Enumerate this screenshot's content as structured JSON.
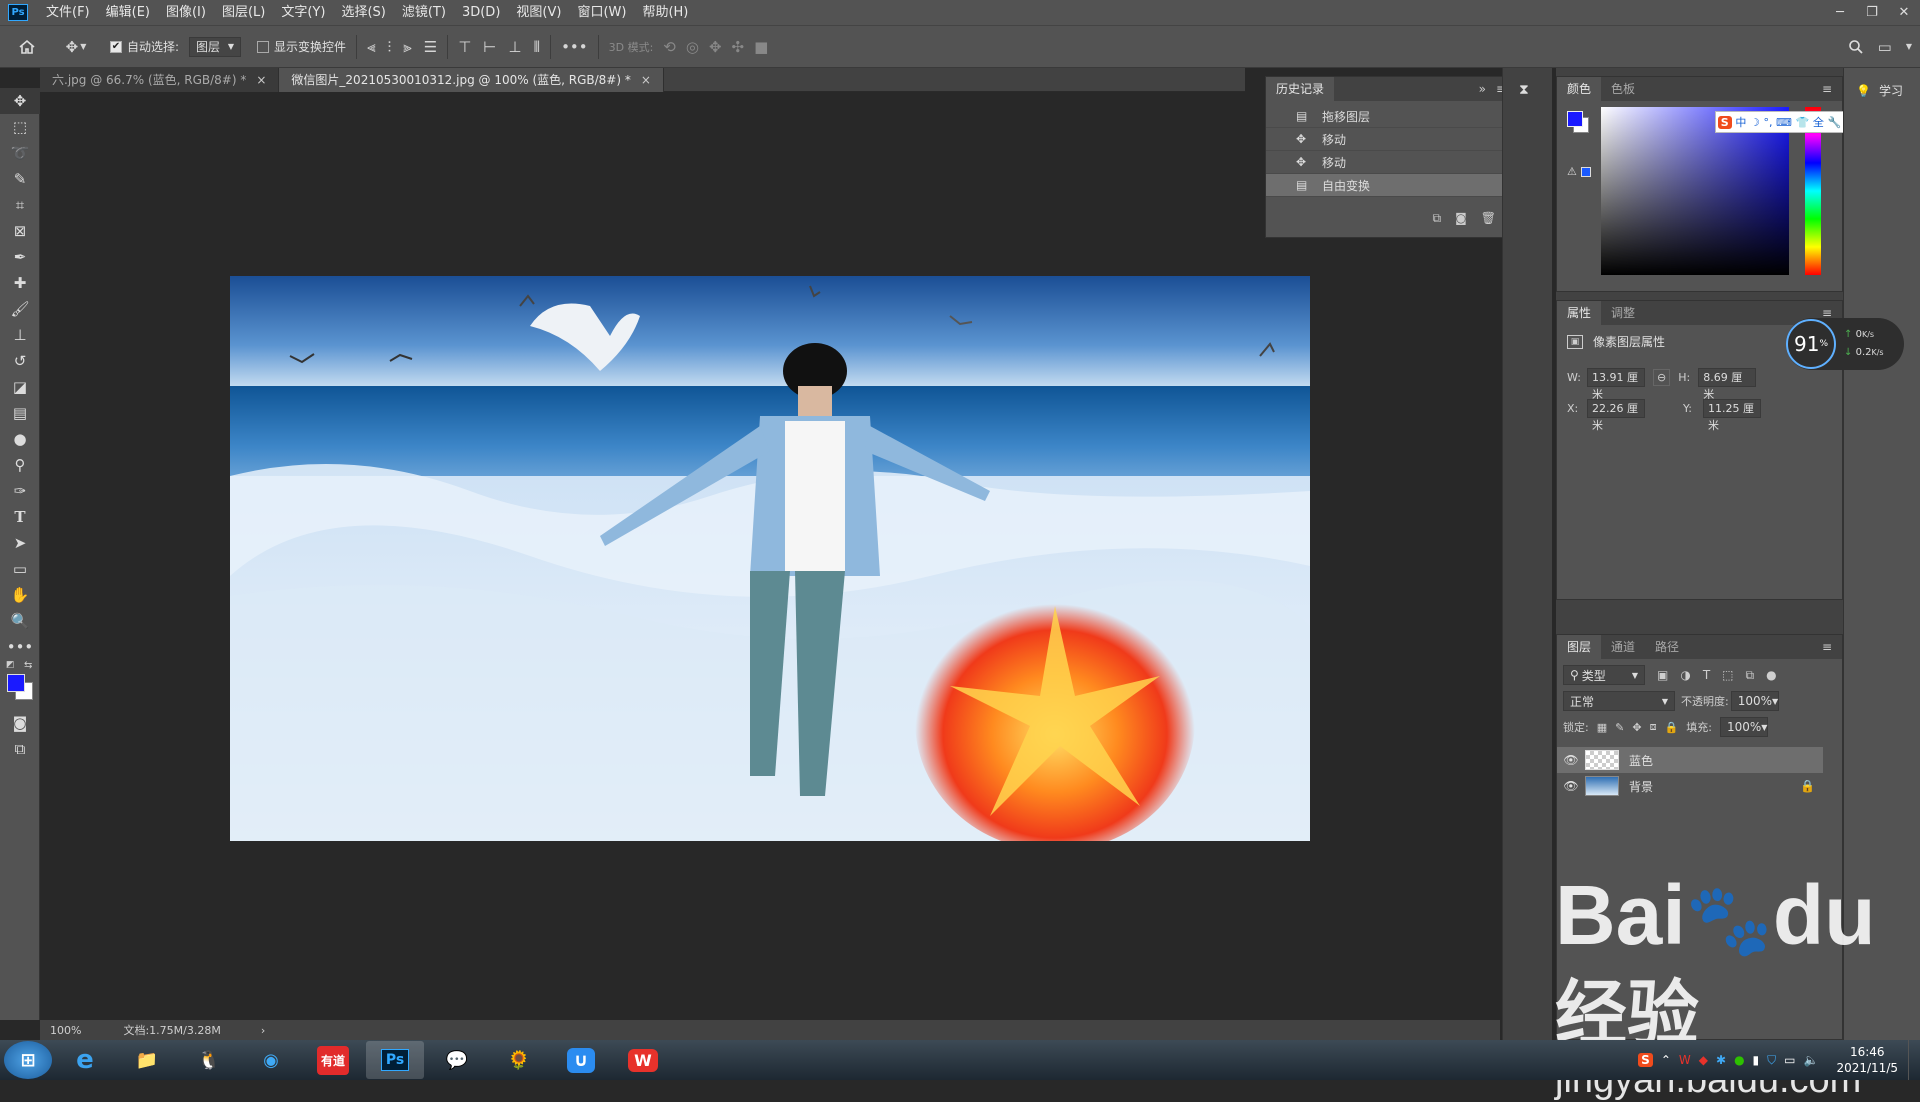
{
  "app": {
    "logo": "Ps"
  },
  "menu": [
    "文件(F)",
    "编辑(E)",
    "图像(I)",
    "图层(L)",
    "文字(Y)",
    "选择(S)",
    "滤镜(T)",
    "3D(D)",
    "视图(V)",
    "窗口(W)",
    "帮助(H)"
  ],
  "options": {
    "auto_select_label": "自动选择:",
    "auto_select_checked": true,
    "auto_select_target": "图层",
    "show_transform_label": "显示变换控件",
    "mode_3d_label": "3D 模式:"
  },
  "tabs": [
    {
      "label": "六.jpg @ 66.7% (蓝色, RGB/8#) *",
      "active": false
    },
    {
      "label": "微信图片_20210530010312.jpg @ 100% (蓝色, RGB/8#) *",
      "active": true
    }
  ],
  "history": {
    "title": "历史记录",
    "items": [
      "拖移图层",
      "移动",
      "移动",
      "自由变换"
    ],
    "selected_index": 3
  },
  "color_panel": {
    "tabs": [
      "颜色",
      "色板"
    ],
    "foreground": "#1a1aff",
    "background": "#ffffff"
  },
  "learn": {
    "label": "学习"
  },
  "properties": {
    "tabs": [
      "属性",
      "调整"
    ],
    "title": "像素图层属性",
    "w_label": "W:",
    "w": "13.91 厘米",
    "h_label": "H:",
    "h": "8.69 厘米",
    "x_label": "X:",
    "x": "22.26 厘米",
    "y_label": "Y:",
    "y": "11.25 厘米"
  },
  "net_widget": {
    "percent": "91",
    "percent_sign": "%",
    "up": "0",
    "down": "0.2",
    "unit": "K/s"
  },
  "layers": {
    "tabs": [
      "图层",
      "通道",
      "路径"
    ],
    "filter": "类型",
    "blend": "正常",
    "opacity_label": "不透明度:",
    "opacity": "100%",
    "lock_label": "锁定:",
    "fill_label": "填充:",
    "fill": "100%",
    "items": [
      {
        "name": "蓝色",
        "selected": true,
        "locked": false
      },
      {
        "name": "背景",
        "selected": false,
        "locked": true
      }
    ]
  },
  "status": {
    "zoom": "100%",
    "doc": "文档:1.75M/3.28M"
  },
  "ime": {
    "items": [
      "S",
      "中",
      "☽",
      "°,",
      "⌨",
      "👕",
      "全",
      "🔧"
    ]
  },
  "taskbar": {
    "apps": [
      "start",
      "ie",
      "explorer",
      "qq",
      "browser",
      "youdao",
      "photoshop",
      "wechat",
      "game",
      "baidu-netdisk",
      "wps"
    ],
    "youdao_label": "有道",
    "time": "16:46",
    "date": "2021/11/5"
  },
  "watermark": {
    "brand": "Bai",
    "brand2": "du",
    "cn": "经验",
    "url": "jingyan.baidu.com"
  },
  "colors": {
    "panel": "#535353",
    "bg": "#282828",
    "accent": "#31a8ff"
  }
}
